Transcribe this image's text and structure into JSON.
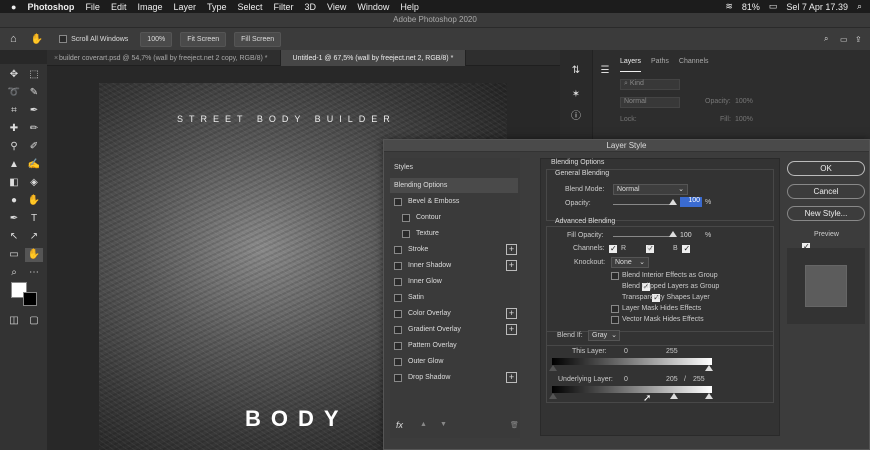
{
  "menubar": {
    "app": "Photoshop",
    "items": [
      "File",
      "Edit",
      "Image",
      "Layer",
      "Type",
      "Select",
      "Filter",
      "3D",
      "View",
      "Window",
      "Help"
    ],
    "title": "Adobe Photoshop 2020",
    "battery": "81%",
    "datetime": "Sel 7 Apr  17.39"
  },
  "options": {
    "scroll_all": "Scroll All Windows",
    "zoom": "100%",
    "fit": "Fit Screen",
    "fill": "Fill Screen"
  },
  "tabs": [
    {
      "label": "builder coverart.psd @ 54,7% (wall by freeject.net 2 copy, RGB/8) *"
    },
    {
      "label": "Untitled-1 @ 67,5% (wall by freeject.net 2, RGB/8) *"
    }
  ],
  "artwork": {
    "heading": "STREET BODY BUILDER",
    "word": "BODY"
  },
  "panel": {
    "tabs": [
      "Layers",
      "Paths",
      "Channels"
    ],
    "kind": "Kind",
    "mode": "Normal",
    "opacity_label": "Opacity:",
    "opacity_value": "100%",
    "lock_label": "Lock:",
    "fill_label": "Fill:",
    "fill_value": "100%"
  },
  "dialog": {
    "title": "Layer Style",
    "styles_header": "Styles",
    "styles": [
      {
        "label": "Blending Options",
        "active": true
      },
      {
        "label": "Bevel & Emboss",
        "plus": false,
        "indent": 0
      },
      {
        "label": "Contour",
        "indent": 1
      },
      {
        "label": "Texture",
        "indent": 1
      },
      {
        "label": "Stroke",
        "plus": true
      },
      {
        "label": "Inner Shadow",
        "plus": true
      },
      {
        "label": "Inner Glow"
      },
      {
        "label": "Satin"
      },
      {
        "label": "Color Overlay",
        "plus": true
      },
      {
        "label": "Gradient Overlay",
        "plus": true
      },
      {
        "label": "Pattern Overlay"
      },
      {
        "label": "Outer Glow"
      },
      {
        "label": "Drop Shadow",
        "plus": true
      }
    ],
    "fx": "fx",
    "blending": {
      "header": "Blending Options",
      "general": "General Blending",
      "blend_mode_label": "Blend Mode:",
      "blend_mode": "Normal",
      "opacity_label": "Opacity:",
      "opacity": "100",
      "pct": "%",
      "advanced": "Advanced Blending",
      "fill_label": "Fill Opacity:",
      "fill": "100",
      "channels_label": "Channels:",
      "ch_r": "R",
      "ch_g": "G",
      "ch_b": "B",
      "knockout_label": "Knockout:",
      "knockout": "None",
      "options": [
        {
          "label": "Blend Interior Effects as Group",
          "checked": false
        },
        {
          "label": "Blend Clipped Layers as Group",
          "checked": true
        },
        {
          "label": "Transparency Shapes Layer",
          "checked": true
        },
        {
          "label": "Layer Mask Hides Effects",
          "checked": false
        },
        {
          "label": "Vector Mask Hides Effects",
          "checked": false
        }
      ],
      "blend_if_label": "Blend If:",
      "blend_if": "Gray",
      "this_layer": "This Layer:",
      "this_min": "0",
      "this_max": "255",
      "under_layer": "Underlying Layer:",
      "under_min": "0",
      "under_mid": "205",
      "under_sep": "/",
      "under_max": "255"
    },
    "buttons": {
      "ok": "OK",
      "cancel": "Cancel",
      "new_style": "New Style...",
      "preview": "Preview"
    }
  }
}
